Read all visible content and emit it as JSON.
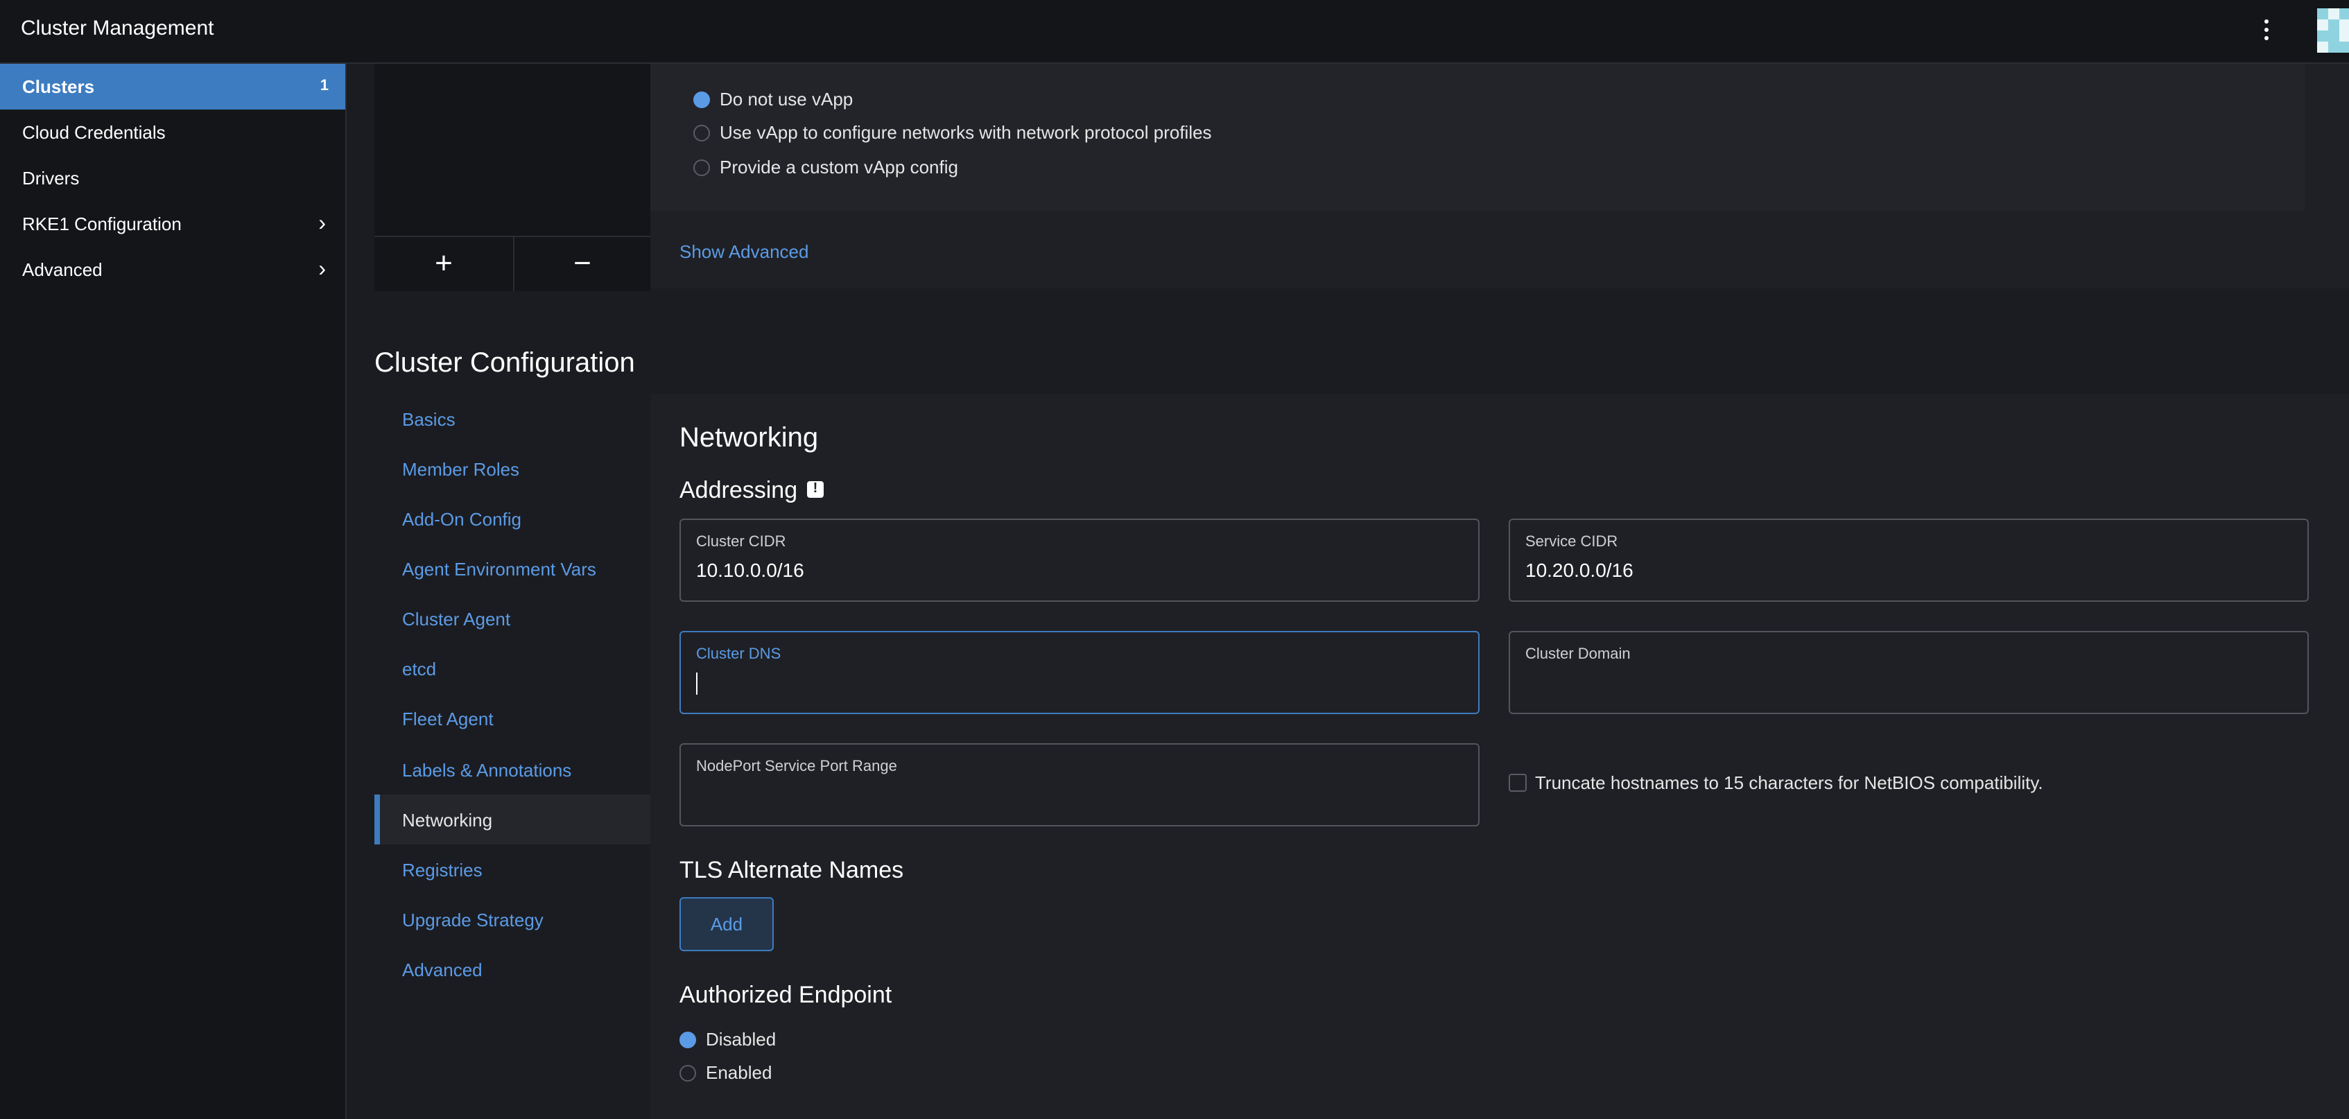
{
  "app": {
    "title": "Cluster Management"
  },
  "sidebar": {
    "items": [
      {
        "label": "Clusters",
        "count": "1"
      },
      {
        "label": "Cloud Credentials"
      },
      {
        "label": "Drivers"
      },
      {
        "label": "RKE1 Configuration"
      },
      {
        "label": "Advanced"
      }
    ]
  },
  "vapp": {
    "options": [
      {
        "label": "Do not use vApp",
        "selected": true
      },
      {
        "label": "Use vApp to configure networks with network protocol profiles",
        "selected": false
      },
      {
        "label": "Provide a custom vApp config",
        "selected": false
      }
    ],
    "show_advanced": "Show Advanced",
    "add_label": "+",
    "remove_label": "−"
  },
  "cluster_config": {
    "title": "Cluster Configuration",
    "nav": [
      "Basics",
      "Member Roles",
      "Add-On Config",
      "Agent Environment Vars",
      "Cluster Agent",
      "etcd",
      "Fleet Agent",
      "Labels & Annotations",
      "Networking",
      "Registries",
      "Upgrade Strategy",
      "Advanced"
    ],
    "active_nav": "Networking"
  },
  "networking": {
    "title": "Networking",
    "addressing": "Addressing",
    "fields": {
      "cluster_cidr": {
        "label": "Cluster CIDR",
        "value": "10.10.0.0/16"
      },
      "service_cidr": {
        "label": "Service CIDR",
        "value": "10.20.0.0/16"
      },
      "cluster_dns": {
        "label": "Cluster DNS",
        "value": ""
      },
      "cluster_domain": {
        "label": "Cluster Domain",
        "value": ""
      },
      "nodeport_range": {
        "label": "NodePort Service Port Range",
        "value": ""
      }
    },
    "truncate_label": "Truncate hostnames to 15 characters for NetBIOS compatibility.",
    "tls_title": "TLS Alternate Names",
    "add_label": "Add",
    "auth_endpoint": {
      "title": "Authorized Endpoint",
      "options": [
        {
          "label": "Disabled",
          "selected": true
        },
        {
          "label": "Enabled",
          "selected": false
        }
      ]
    }
  },
  "colors": {
    "accent": "#3d7cc0",
    "link": "#5b9be6",
    "background": "#1b1c21"
  }
}
